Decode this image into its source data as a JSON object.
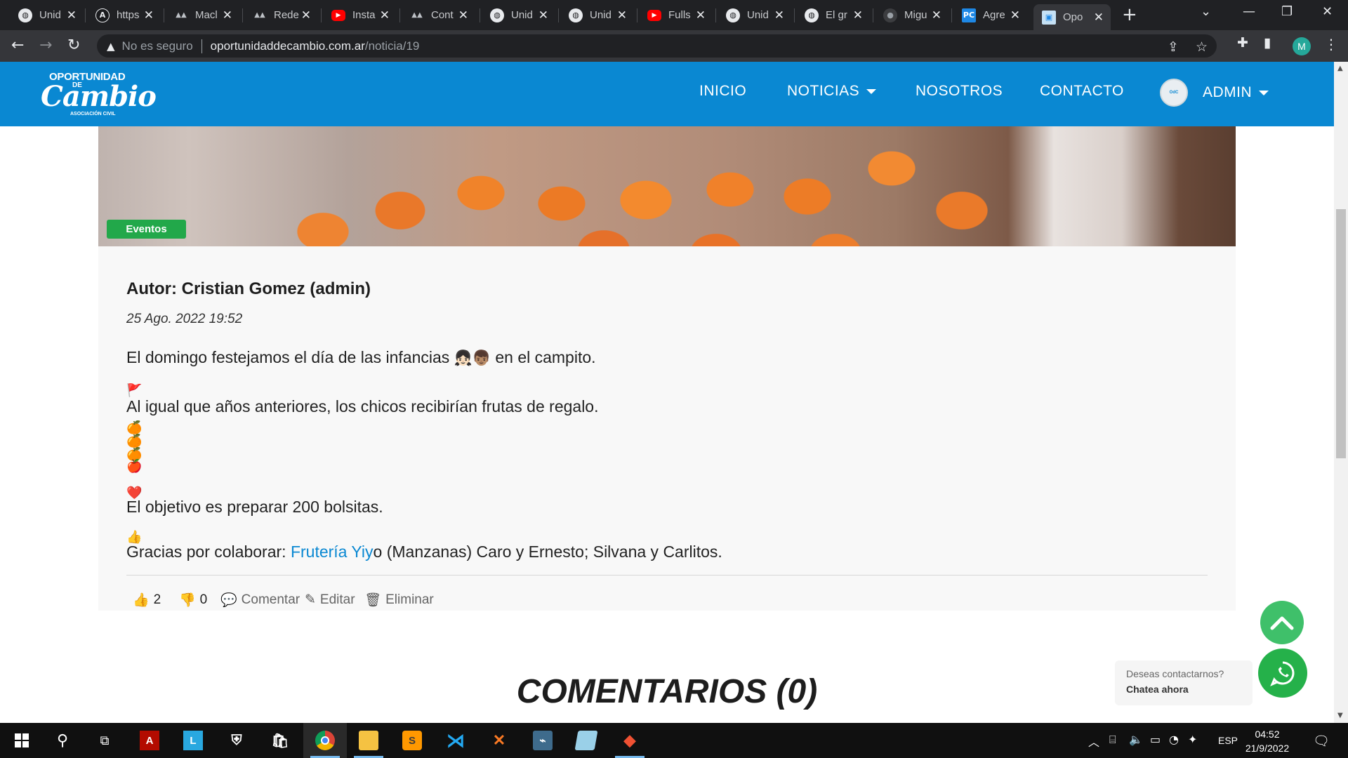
{
  "browser": {
    "tabs": [
      {
        "label": "Unid",
        "icon": "globe-icon"
      },
      {
        "label": "https",
        "icon": "a-icon"
      },
      {
        "label": "Macl",
        "icon": "ba-icon"
      },
      {
        "label": "Rede",
        "icon": "ba-icon"
      },
      {
        "label": "Insta",
        "icon": "youtube-icon"
      },
      {
        "label": "Cont",
        "icon": "ba-icon"
      },
      {
        "label": "Unid",
        "icon": "globe-icon"
      },
      {
        "label": "Unid",
        "icon": "globe-icon"
      },
      {
        "label": "Fulls",
        "icon": "youtube-icon"
      },
      {
        "label": "Unid",
        "icon": "globe-icon"
      },
      {
        "label": "El gr",
        "icon": "globe-icon"
      },
      {
        "label": "Migu",
        "icon": "github-icon"
      },
      {
        "label": "Agre",
        "icon": "pc-icon"
      },
      {
        "label": "Opo",
        "icon": "site-icon"
      }
    ],
    "address": {
      "insecure_label": "No es seguro",
      "domain": "oportunidaddecambio.com.ar",
      "path": "/noticia/19"
    },
    "profile_initial": "M"
  },
  "site": {
    "logo": {
      "line1": "OPORTUNIDAD",
      "line2": "DE",
      "line3": "Cambio",
      "line4": "ASOCIACIÓN CIVIL"
    },
    "nav": {
      "inicio": "INICIO",
      "noticias": "NOTICIAS",
      "nosotros": "NOSOTROS",
      "contacto": "CONTACTO",
      "admin": "ADMIN"
    }
  },
  "post": {
    "category": "Eventos",
    "author": "Autor: Cristian Gomez (admin)",
    "date": "25 Ago. 2022 19:52",
    "p1_before": "El domingo festejamos el día de las infancias",
    "p1_emoji": "👧🏻👦🏽",
    "p1_after": "en el campito.",
    "e_flag": "🚩",
    "p2": "Al igual que años anteriores, los chicos recibirían frutas de regalo.",
    "e_fruit1": "🍊",
    "e_fruit2": "🍎",
    "e_heart": "❤️",
    "p3": "El objetivo es preparar 200 bolsitas.",
    "e_thumb": "👍",
    "p4_before": "Gracias por colaborar: ",
    "p4_link": "Frutería Yiy",
    "p4_after": "o (Manzanas) Caro y Ernesto; Silvana y Carlitos.",
    "likes": "2",
    "dislikes": "0",
    "comment_label": "Comentar",
    "edit_label": "Editar",
    "delete_label": "Eliminar"
  },
  "comments": {
    "title": "COMENTARIOS (0)"
  },
  "whatsapp": {
    "question": "Deseas contactarnos?",
    "cta": "Chatea ahora"
  },
  "taskbar": {
    "language": "ESP",
    "time": "04:52",
    "date": "21/9/2022"
  }
}
